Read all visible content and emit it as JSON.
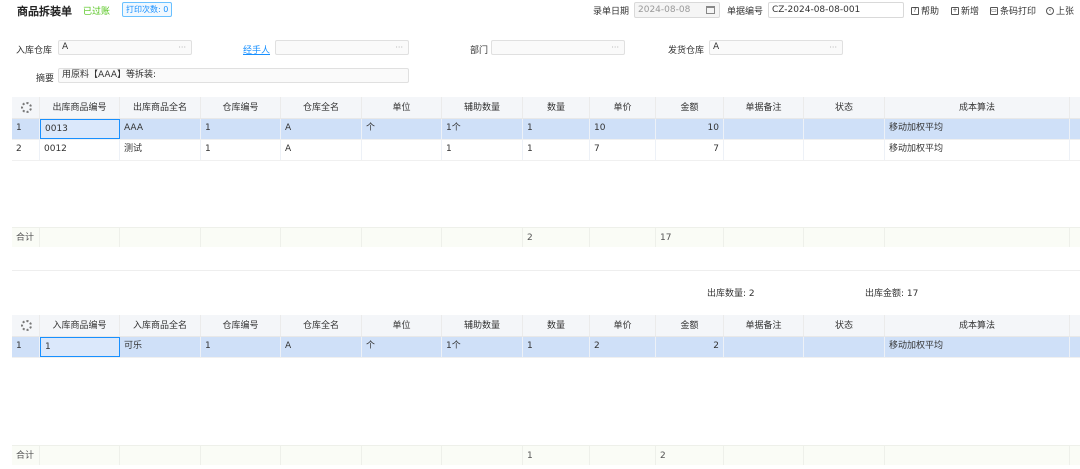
{
  "header": {
    "title": "商品拆装单",
    "status": "已过账",
    "print_count": "打印次数: 0",
    "date_label": "录单日期",
    "date_value": "2024-08-08",
    "no_label": "单据编号",
    "no_value": "CZ-2024-08-08-001",
    "buttons": {
      "help": "帮助",
      "new": "新增",
      "barcode": "条码打印",
      "prev": "上张"
    }
  },
  "form": {
    "in_warehouse_label": "入库仓库",
    "in_warehouse_value": "A",
    "handler_label": "经手人",
    "handler_value": "",
    "dept_label": "部门",
    "dept_value": "",
    "out_warehouse_label": "发货仓库",
    "out_warehouse_value": "A",
    "summary_label": "摘要",
    "summary_value": "用原料【AAA】等拆装:"
  },
  "colors": {
    "accent": "#1890ff",
    "selected_row": "#cfe0f8",
    "status_green": "#52c41a"
  },
  "out_table": {
    "headers": [
      "出库商品编号",
      "出库商品全名",
      "仓库编号",
      "仓库全名",
      "单位",
      "辅助数量",
      "数量",
      "单价",
      "金额",
      "单据备注",
      "状态",
      "成本算法"
    ],
    "rows": [
      {
        "idx": "1",
        "code": "0013",
        "name": "AAA",
        "wh_no": "1",
        "wh_name": "A",
        "unit": "个",
        "aux_qty": "1个",
        "qty": "1",
        "price": "10",
        "amount": "10",
        "remark": "",
        "status": "",
        "method": "移动加权平均"
      },
      {
        "idx": "2",
        "code": "0012",
        "name": "测试",
        "wh_no": "1",
        "wh_name": "A",
        "unit": "",
        "aux_qty": "1",
        "qty": "1",
        "price": "7",
        "amount": "7",
        "remark": "",
        "status": "",
        "method": "移动加权平均"
      }
    ],
    "footer": {
      "label": "合计",
      "qty": "2",
      "amount": "17"
    }
  },
  "summary": {
    "out_qty_label": "出库数量:",
    "out_qty_value": "2",
    "out_amount_label": "出库金额:",
    "out_amount_value": "17"
  },
  "in_table": {
    "headers": [
      "入库商品编号",
      "入库商品全名",
      "仓库编号",
      "仓库全名",
      "单位",
      "辅助数量",
      "数量",
      "单价",
      "金额",
      "单据备注",
      "状态",
      "成本算法"
    ],
    "rows": [
      {
        "idx": "1",
        "code": "1",
        "name": "可乐",
        "wh_no": "1",
        "wh_name": "A",
        "unit": "个",
        "aux_qty": "1个",
        "qty": "1",
        "price": "2",
        "amount": "2",
        "remark": "",
        "status": "",
        "method": "移动加权平均"
      }
    ],
    "footer": {
      "label": "合计",
      "qty": "1",
      "amount": "2"
    }
  }
}
